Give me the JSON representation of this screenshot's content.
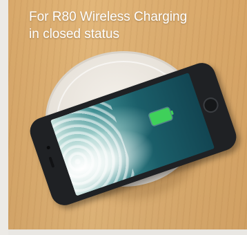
{
  "caption": {
    "line1": "For R80 Wireless Charging",
    "line2": "in closed status"
  }
}
